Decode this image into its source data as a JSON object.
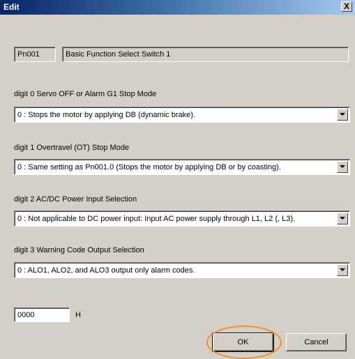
{
  "window": {
    "title": "Edit",
    "close_glyph": "X"
  },
  "parameter": {
    "number": "Pn001",
    "name": "Basic Function Select Switch 1"
  },
  "digits": [
    {
      "label": "digit 0  Servo OFF or Alarm G1 Stop Mode",
      "value": "0 : Stops the motor by applying DB (dynamic brake)."
    },
    {
      "label": "digit 1  Overtravel (OT) Stop Mode",
      "value": "0 : Same setting as Pn001.0 (Stops the motor by applying DB or by coasting)."
    },
    {
      "label": "digit 2  AC/DC Power Input Selection",
      "value": "0 : Not applicable to DC power input: Input AC power supply through L1, L2 (, L3)."
    },
    {
      "label": "digit 3  Warning Code Output Selection",
      "value": "0 : ALO1, ALO2, and ALO3 output only alarm codes."
    }
  ],
  "hex": {
    "value": "0000",
    "unit": "H"
  },
  "buttons": {
    "ok": "OK",
    "cancel": "Cancel"
  },
  "colors": {
    "highlight": "#f0902a",
    "titlebar": "#0a246a"
  }
}
